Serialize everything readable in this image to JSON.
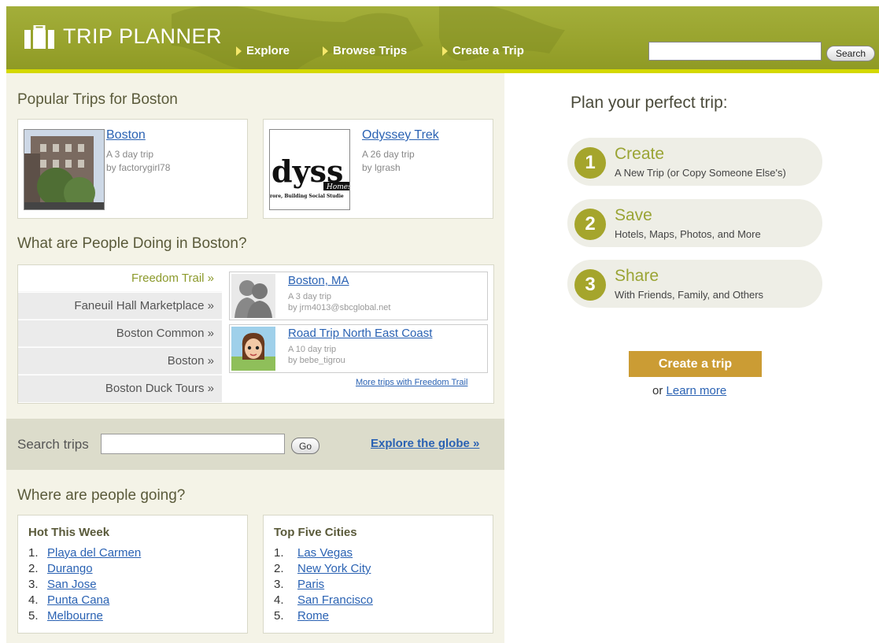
{
  "header": {
    "logo_text": "TRIP PLANNER",
    "nav": [
      {
        "label": "Explore"
      },
      {
        "label": "Browse Trips"
      },
      {
        "label": "Create a Trip"
      }
    ],
    "search_value": "",
    "search_button": "Search",
    "colors": {
      "header_bg": "#98a32d",
      "accent_strip": "#d4d800"
    }
  },
  "popular": {
    "title": "Popular Trips for Boston",
    "trips": [
      {
        "name": "Boston",
        "length": "A 3 day trip",
        "author": "by factorygirl78"
      },
      {
        "name": "Odyssey Trek",
        "length": "A 26 day trip",
        "author": "by lgrash",
        "thumb_text": "dyss",
        "thumb_sub": "Homesc",
        "thumb_caption": "rore, Building Social Studie"
      }
    ]
  },
  "doing": {
    "title": "What are People Doing in Boston?",
    "places": [
      {
        "label": "Freedom Trail »",
        "active": true
      },
      {
        "label": "Faneuil Hall Marketplace »"
      },
      {
        "label": "Boston Common »"
      },
      {
        "label": "Boston »"
      },
      {
        "label": "Boston Duck Tours »"
      }
    ],
    "trips": [
      {
        "name": "Boston, MA",
        "length": "A 3 day trip",
        "author": "by jrm4013@sbcglobal.net"
      },
      {
        "name": "Road Trip North East Coast",
        "length": "A 10 day trip",
        "author": "by bebe_tigrou"
      }
    ],
    "more_link": "More trips with Freedom Trail"
  },
  "search_trips": {
    "label": "Search trips",
    "value": "",
    "go_button": "Go",
    "explore_link": "Explore the globe »"
  },
  "going": {
    "title": "Where are people going?",
    "hot": {
      "heading": "Hot This Week",
      "items": [
        "Playa del Carmen",
        "Durango",
        "San Jose",
        "Punta Cana",
        "Melbourne"
      ]
    },
    "top": {
      "heading": "Top Five Cities",
      "items": [
        "Las Vegas",
        "New York City",
        "Paris",
        "San Francisco",
        "Rome"
      ]
    },
    "numbers": [
      "1.",
      "2.",
      "3.",
      "4.",
      "5."
    ]
  },
  "plan": {
    "title": "Plan your perfect trip:",
    "steps": [
      {
        "num": "1",
        "title": "Create",
        "desc": "A New Trip (or Copy Someone Else's)"
      },
      {
        "num": "2",
        "title": "Save",
        "desc": "Hotels, Maps, Photos, and More"
      },
      {
        "num": "3",
        "title": "Share",
        "desc": "With Friends, Family, and Others"
      }
    ],
    "create_button": "Create a trip",
    "or_text": "or",
    "learn_more": "Learn more",
    "colors": {
      "step_circle": "#a5a52c",
      "create_button": "#cb9c34"
    }
  }
}
